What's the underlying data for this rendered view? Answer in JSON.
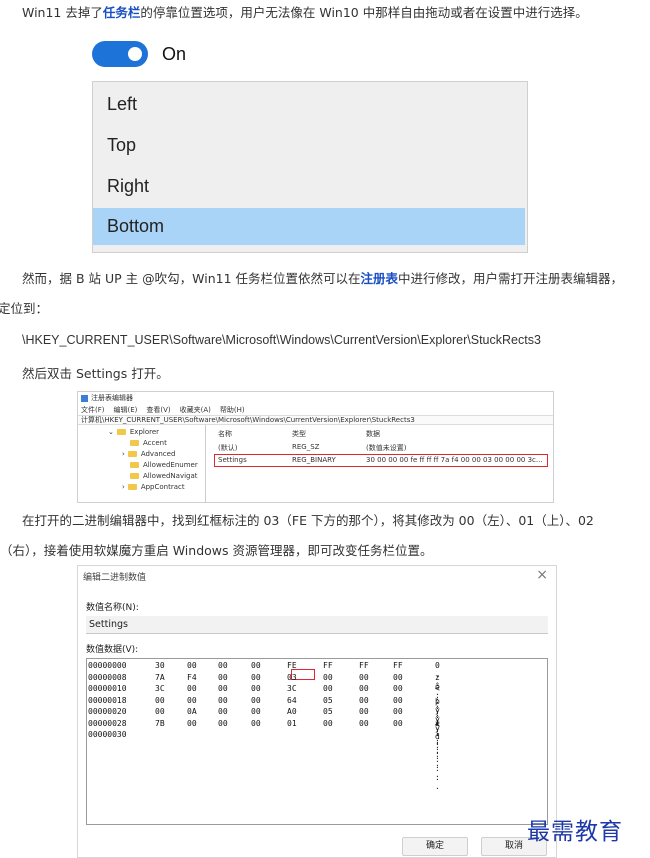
{
  "intro": {
    "before": "Win11 去掉了",
    "link": "任务栏",
    "after": "的停靠位置选项，用户无法像在 Win10 中那样自由拖动或者在设置中进行选择。"
  },
  "toggle": {
    "label": "On",
    "state": "on",
    "accent": "#1e73d8"
  },
  "positions": {
    "options": [
      "Left",
      "Top",
      "Right",
      "Bottom"
    ],
    "selected": "Bottom",
    "selected_color": "#a9d4f7"
  },
  "para2": {
    "before": "然而，据 B 站 UP 主 @吹勾，Win11 任务栏位置依然可以在",
    "link": "注册表",
    "after": "中进行修改，用户需打开注册表编辑器，",
    "line2": "定位到："
  },
  "registry_path": "\\HKEY_CURRENT_USER\\Software\\Microsoft\\Windows\\CurrentVersion\\Explorer\\StuckRects3",
  "para3": "然后双击 Settings 打开。",
  "regedit": {
    "title": "注册表编辑器",
    "menu": [
      "文件(F)",
      "编辑(E)",
      "查看(V)",
      "收藏夹(A)",
      "帮助(H)"
    ],
    "address": "计算机\\HKEY_CURRENT_USER\\Software\\Microsoft\\Windows\\CurrentVersion\\Explorer\\StuckRects3",
    "tree": [
      "Explorer",
      "Accent",
      "Advanced",
      "AllowedEnumer",
      "AllowedNavigat",
      "AppContract"
    ],
    "columns": [
      "名称",
      "类型",
      "数据"
    ],
    "rows": [
      {
        "name": "(默认)",
        "type": "REG_SZ",
        "data": "(数值未设置)"
      },
      {
        "name": "Settings",
        "type": "REG_BINARY",
        "data": "30 00 00 00 fe ff ff ff 7a f4 00 00 03 00 00 00 3c..."
      }
    ]
  },
  "para4": {
    "line1": "在打开的二进制编辑器中，找到红框标注的 03（FE 下方的那个），将其修改为 00（左）、01（上）、02",
    "line2": "（右），接着使用软媒魔方重启 Windows 资源管理器，即可改变任务栏位置。"
  },
  "binary_editor": {
    "title": "编辑二进制数值",
    "close": "×",
    "name_label": "数值名称(N):",
    "name_value": "Settings",
    "data_label": "数值数据(V):",
    "rows": [
      {
        "addr": "00000000",
        "bytes": [
          "30",
          "00",
          "00",
          "00",
          "FE",
          "FF",
          "FF",
          "FF"
        ],
        "ascii": "0 . . . þ ÿ ÿ ÿ"
      },
      {
        "addr": "00000008",
        "bytes": [
          "7A",
          "F4",
          "00",
          "00",
          "03",
          "00",
          "00",
          "00"
        ],
        "ascii": "z ô . . . . . ."
      },
      {
        "addr": "00000010",
        "bytes": [
          "3C",
          "00",
          "00",
          "00",
          "3C",
          "00",
          "00",
          "00"
        ],
        "ascii": "< . . . < . . ."
      },
      {
        "addr": "00000018",
        "bytes": [
          "00",
          "00",
          "00",
          "00",
          "64",
          "05",
          "00",
          "00"
        ],
        "ascii": ". . . . d . . ."
      },
      {
        "addr": "00000020",
        "bytes": [
          "00",
          "0A",
          "00",
          "00",
          "A0",
          "05",
          "00",
          "00"
        ],
        "ascii": ". . . . . . . ."
      },
      {
        "addr": "00000028",
        "bytes": [
          "7B",
          "00",
          "00",
          "00",
          "01",
          "00",
          "00",
          "00"
        ],
        "ascii": "x . . . . . . ."
      },
      {
        "addr": "00000030",
        "bytes": [],
        "ascii": ""
      }
    ],
    "ok_label": "确定",
    "cancel_label": "取消"
  },
  "watermark": "最需教育"
}
